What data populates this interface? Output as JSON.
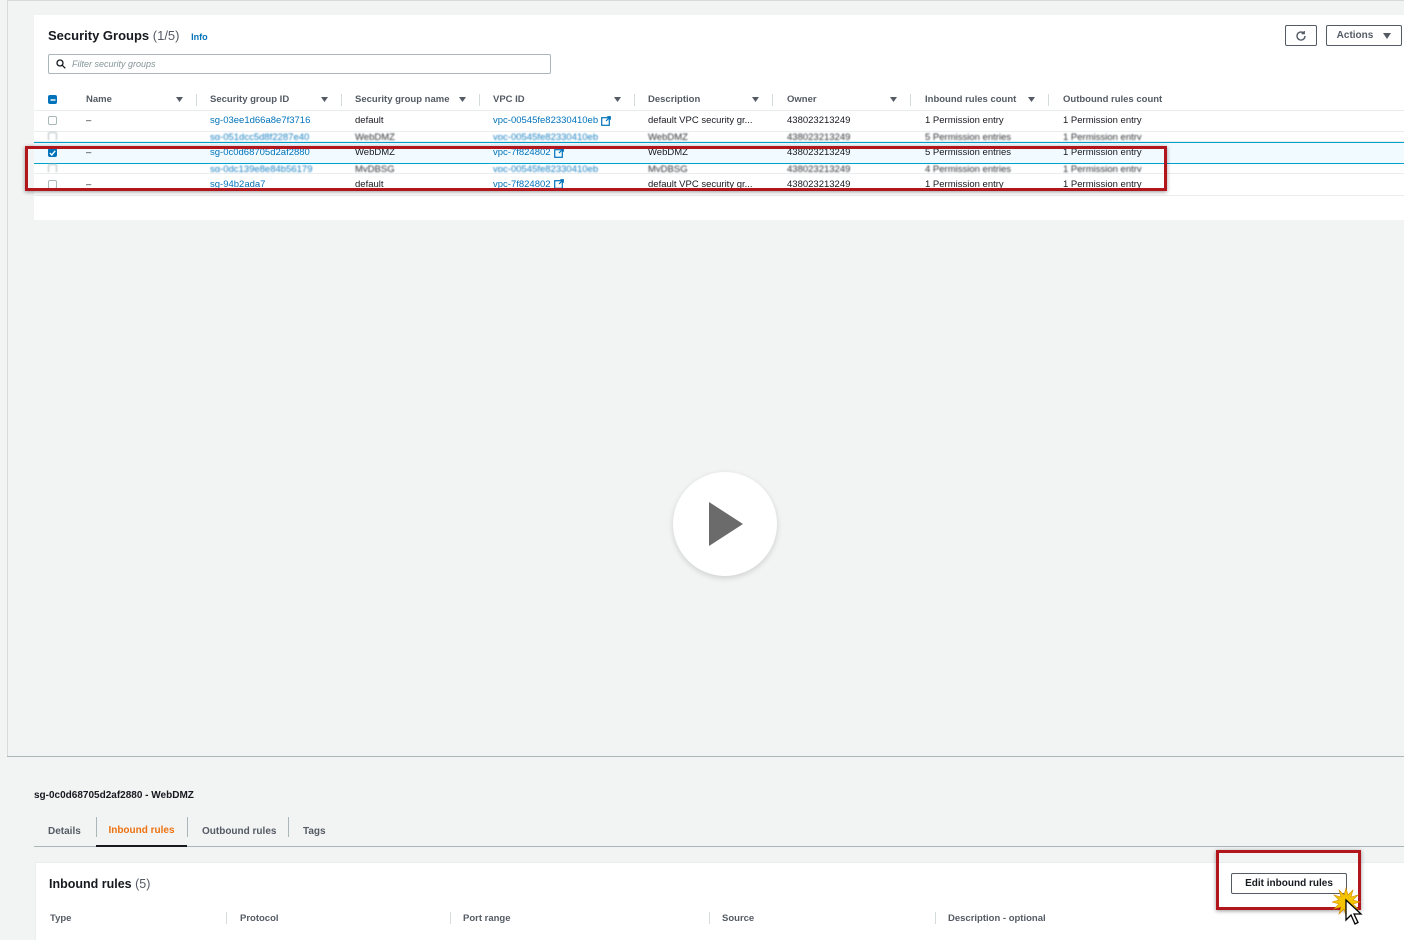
{
  "security_groups": {
    "title": "Security Groups",
    "count": "(1/5)",
    "info_link": "Info",
    "actions_label": "Actions",
    "filter_placeholder": "Filter security groups",
    "columns": [
      "Name",
      "Security group ID",
      "Security group name",
      "VPC ID",
      "Description",
      "Owner",
      "Inbound rules count",
      "Outbound rules count"
    ],
    "rows": [
      {
        "name": "–",
        "sg_id": "sg-03ee1d66a8e7f3716",
        "sg_name": "default",
        "vpc_id": "vpc-00545fe82330410eb",
        "description": "default VPC security gr...",
        "owner": "438023213249",
        "inbound": "1 Permission entry",
        "outbound": "1 Permission entry",
        "selected": false
      },
      {
        "name": "–",
        "sg_id": "sg-0c0d68705d2af2880",
        "sg_name": "WebDMZ",
        "vpc_id": "vpc-7f824802",
        "description": "WebDMZ",
        "owner": "438023213249",
        "inbound": "5 Permission entries",
        "outbound": "1 Permission entry",
        "selected": true
      },
      {
        "name": "–",
        "sg_id": "sg-94b2ada7",
        "sg_name": "default",
        "vpc_id": "vpc-7f824802",
        "description": "default VPC security gr...",
        "owner": "438023213249",
        "inbound": "1 Permission entry",
        "outbound": "1 Permission entry",
        "selected": false
      }
    ],
    "blurred_rows": [
      {
        "sg_id": "sg-051dcc5d8f2287e40",
        "sg_name": "WebDMZ",
        "vpc_id": "vpc-00545fe82330410eb",
        "description": "WebDMZ",
        "owner": "438023213249",
        "inbound": "5 Permission entries",
        "outbound": "1 Permission entry"
      },
      {
        "sg_id": "sg-0dc139e8e84b56179",
        "sg_name": "MyDBSG",
        "vpc_id": "vpc-00545fe82330410eb",
        "description": "MyDBSG",
        "owner": "438023213249",
        "inbound": "4 Permission entries",
        "outbound": "1 Permission entry"
      }
    ]
  },
  "details": {
    "title": "sg-0c0d68705d2af2880 - WebDMZ",
    "tabs": [
      "Details",
      "Inbound rules",
      "Outbound rules",
      "Tags"
    ],
    "active_tab": "Inbound rules",
    "inbound_title": "Inbound rules",
    "inbound_count": "(5)",
    "edit_button": "Edit inbound rules",
    "columns": [
      "Type",
      "Protocol",
      "Port range",
      "Source",
      "Description - optional"
    ]
  },
  "colors": {
    "link": "#0073bb",
    "active_tab": "#ec7211",
    "highlight": "#b0161b",
    "selected_row": "#f1faff"
  }
}
